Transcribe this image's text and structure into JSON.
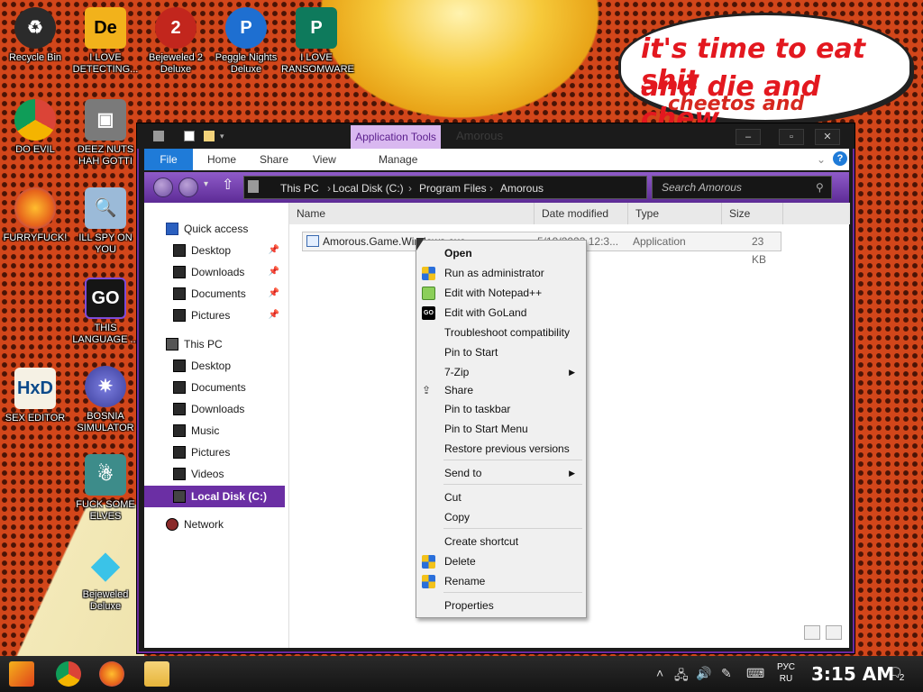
{
  "wallpaper": {
    "speech_lines": [
      "it's time to eat shit",
      "and die and chew",
      "cheetos and"
    ]
  },
  "desktop_icons": [
    {
      "label": "Recycle Bin",
      "icon": "recycle-bin-icon",
      "color": "#2b2b2b"
    },
    {
      "label": "I LOVE DETECTING...",
      "icon": "de-icon",
      "color": "#f2b21b"
    },
    {
      "label": "Bejeweled 2 Deluxe",
      "icon": "bejeweled2-icon",
      "color": "#c2261d"
    },
    {
      "label": "Peggle Nights Deluxe",
      "icon": "peggle-icon",
      "color": "#1e6fd1"
    },
    {
      "label": "I LOVE RANSOMWARE",
      "icon": "publisher-icon",
      "color": "#0e7a5c"
    },
    {
      "label": "DO EVIL",
      "icon": "chrome-icon",
      "color": "#3c8c2e"
    },
    {
      "label": "DEEZ NUTS HAH GOTTI",
      "icon": "windows-stack-icon",
      "color": "#7a7a7a"
    },
    {
      "label": "FURRYFUCK!",
      "icon": "firefox-icon",
      "color": "#e6621b"
    },
    {
      "label": "ILL SPY ON YOU",
      "icon": "spy-icon",
      "color": "#9bbad8"
    },
    {
      "label": "THIS LANGUAGE ...",
      "icon": "goland-icon",
      "color": "#151515"
    },
    {
      "label": "SEX EDITOR",
      "icon": "hxd-icon",
      "color": "#f5f1e4"
    },
    {
      "label": "BOSNIA SIMULATOR",
      "icon": "spike-ball-icon",
      "color": "#4c4fb5"
    },
    {
      "label": "FUCK SOME ELVES",
      "icon": "santa-icon",
      "color": "#3d8c8a"
    },
    {
      "label": "Bejeweled Deluxe",
      "icon": "diamond-icon",
      "color": "#3ac3e8"
    }
  ],
  "window": {
    "contextual_tab": "Application Tools",
    "title": "Amorous",
    "controls": {
      "minimize": "–",
      "maximize": "▫",
      "close": "✕"
    },
    "ribbon_tabs": [
      "File",
      "Home",
      "Share",
      "View"
    ],
    "contextual_subtab": "Manage",
    "breadcrumb": [
      "This PC",
      "Local Disk (C:)",
      "Program Files",
      "Amorous"
    ],
    "search_placeholder": "Search Amorous"
  },
  "nav": {
    "quick_access": "Quick access",
    "quick_items": [
      "Desktop",
      "Downloads",
      "Documents",
      "Pictures"
    ],
    "this_pc": "This PC",
    "pc_items": [
      "Desktop",
      "Documents",
      "Downloads",
      "Music",
      "Pictures",
      "Videos"
    ],
    "local_disk": "Local Disk (C:)",
    "network": "Network"
  },
  "columns": [
    "Name",
    "Date modified",
    "Type",
    "Size"
  ],
  "file": {
    "name": "Amorous.Game.Windows.exe",
    "date": "5/19/2023 12:3...",
    "type": "Application",
    "size": "23 KB"
  },
  "context_menu": [
    "Open",
    "Run as administrator",
    "Edit with Notepad++",
    "Edit with GoLand",
    "Troubleshoot compatibility",
    "Pin to Start",
    "7-Zip",
    "Share",
    "Pin to taskbar",
    "Pin to Start Menu",
    "Restore previous versions",
    "Send to",
    "Cut",
    "Copy",
    "Create shortcut",
    "Delete",
    "Rename",
    "Properties"
  ],
  "taskbar": {
    "lang_line1": "РУС",
    "lang_line2": "RU",
    "time": "3:15 AM",
    "notifications": "2"
  },
  "colors": {
    "accent_purple": "#6b2fa4",
    "file_tab_blue": "#1f7bd8"
  }
}
